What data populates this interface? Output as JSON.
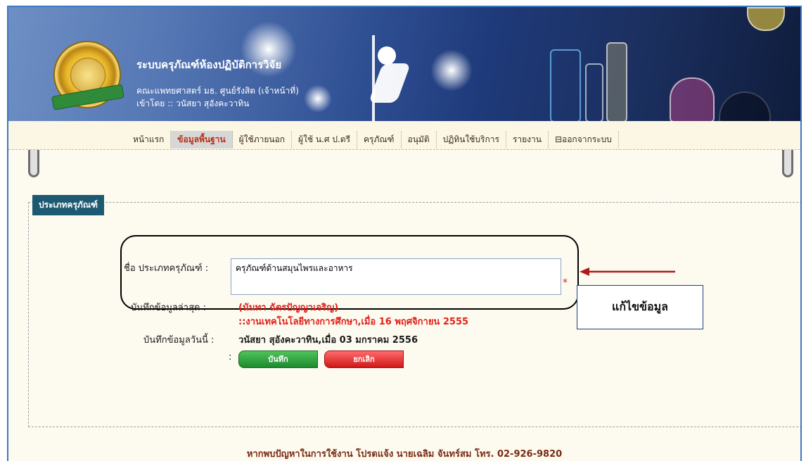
{
  "header": {
    "app_title": "ระบบครุภัณฑ์ห้องปฏิบัติการวิจัย",
    "subtitle": "คณะแพทยศาสตร์ มธ. ศูนย์รังสิต (เจ้าหน้าที่)",
    "logged_in_as": "เข้าโดย :: วนัสยา สุอังคะวาทิน"
  },
  "nav": {
    "items": [
      {
        "label": "หน้าแรก",
        "active": false
      },
      {
        "label": "ข้อมูลพื้นฐาน",
        "active": true
      },
      {
        "label": "ผู้ใช้ภายนอก",
        "active": false
      },
      {
        "label": "ผู้ใช้ น.ศ ป.ตรี",
        "active": false
      },
      {
        "label": "ครุภัณฑ์",
        "active": false
      },
      {
        "label": "อนุมัติ",
        "active": false
      },
      {
        "label": "ปฏิทินใช้บริการ",
        "active": false
      },
      {
        "label": "รายงาน",
        "active": false
      },
      {
        "label": "ออกจากระบบ",
        "active": false
      }
    ]
  },
  "form": {
    "section_title": "ประเภทครุภัณฑ์",
    "name_label": "ชื่อ ประเภทครุภัณฑ์ :",
    "name_value": "ครุภัณฑ์ด้านสมุนไพรและอาหาร",
    "required_mark": "*",
    "last_saved_label": "บันทึกข้อมูลล่าสุด :",
    "last_saved_by": "(นันทา ฉัตรปัญญาเจริญ)",
    "last_saved_detail": "::งานเทคโนโลยีทางการศึกษา,เมื่อ 16 พฤศจิกายน 2555",
    "today_label": "บันทึกข้อมูลวันนี้ :",
    "today_value": "วนัสยา สุอังคะวาทิน,เมื่อ 03 มกราคม 2556",
    "colon": ":",
    "save_label": "บันทึก",
    "cancel_label": "ยกเลิก"
  },
  "callout": {
    "text": "แก้ไขข้อมูล"
  },
  "footer": {
    "text": "หากพบปัญหาในการใช้งาน โปรดแจ้ง นายเฉลิม จันทร์สม โทร. 02-926-9820"
  },
  "colors": {
    "header_blue": "#1f3a7a",
    "legend_bg": "#1d5a72",
    "accent_red": "#e0201a",
    "save_green": "#1d8a2d",
    "cancel_red": "#d01818"
  },
  "icons": {
    "logo": "university-seal-logo",
    "logout": "logout-icon",
    "arrow": "arrow-left-icon"
  }
}
